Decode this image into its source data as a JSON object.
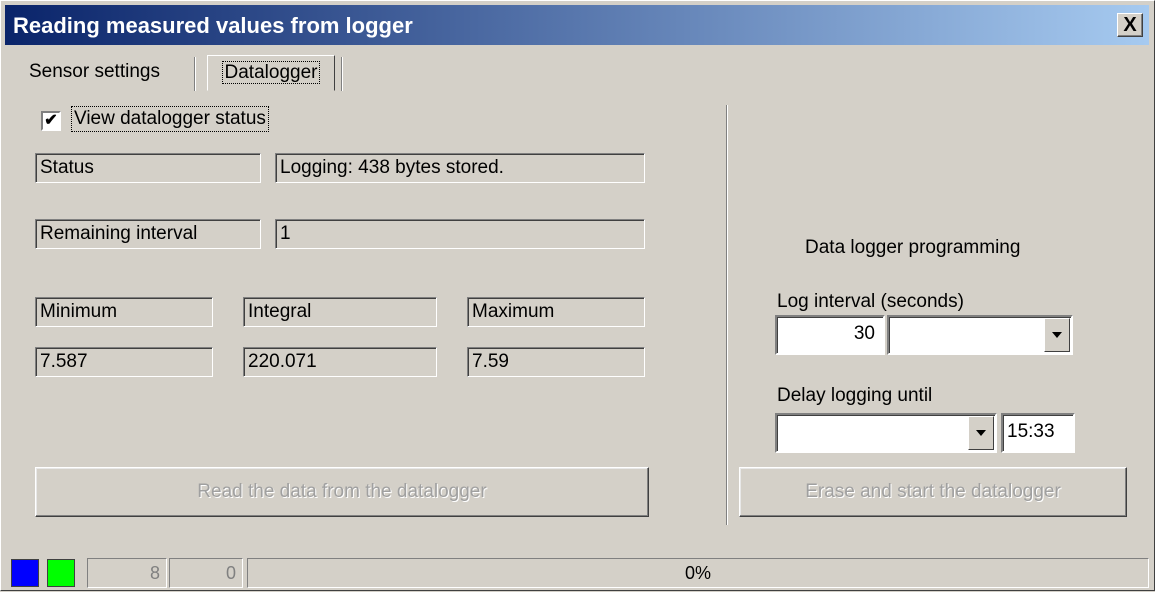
{
  "window": {
    "title": "Reading measured values from logger",
    "close_label": "X"
  },
  "tabs": [
    {
      "label": "Sensor settings"
    },
    {
      "label": "Datalogger"
    }
  ],
  "view_status": {
    "label": "View datalogger status",
    "checked": true,
    "check_glyph": "✔"
  },
  "status": {
    "label": "Status",
    "value": "Logging: 438 bytes stored."
  },
  "remaining": {
    "label": "Remaining interval",
    "value": "1"
  },
  "stats": {
    "minimum_label": "Minimum",
    "integral_label": "Integral",
    "maximum_label": "Maximum",
    "minimum_value": "7.587",
    "integral_value": "220.071",
    "maximum_value": "7.59"
  },
  "read_button": {
    "label": "Read the data from the datalogger"
  },
  "programming": {
    "heading": "Data logger programming",
    "log_interval_label": "Log interval (seconds)",
    "log_interval_value": "30",
    "delay_label": "Delay logging until",
    "delay_time": "15:33",
    "erase_button": "Erase and start the datalogger"
  },
  "statusbar": {
    "swatch_colors": [
      "#0000ff",
      "#00ff00"
    ],
    "count1": "8",
    "count2": "0",
    "progress_text": "0%",
    "progress_fraction": 0
  }
}
